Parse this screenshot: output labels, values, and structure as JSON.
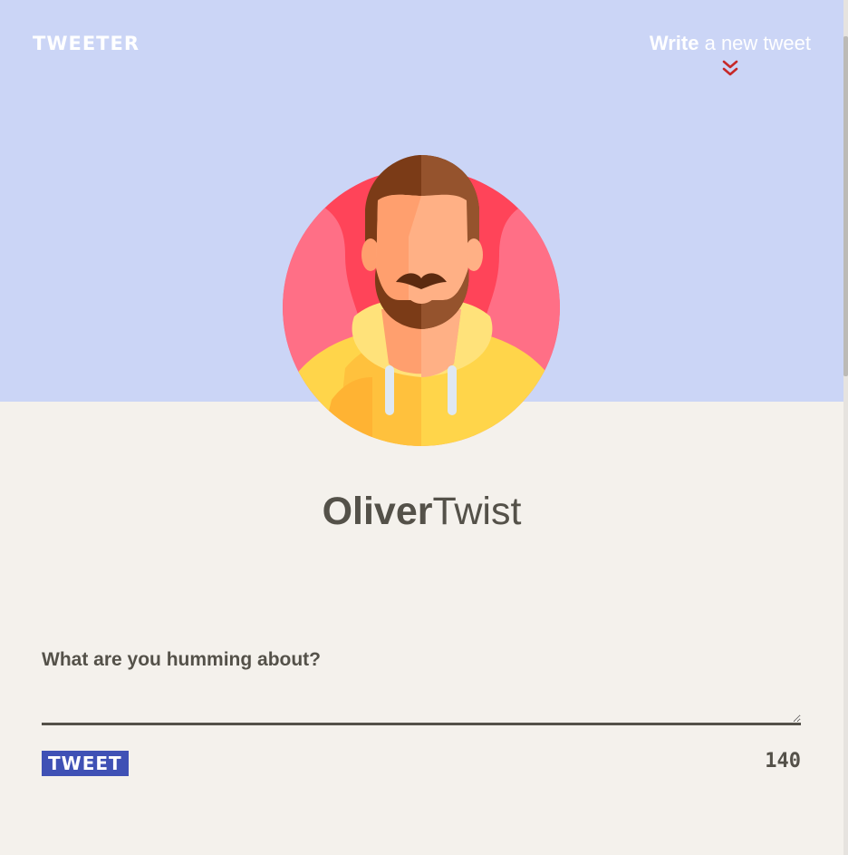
{
  "nav": {
    "logo": "TWEETER",
    "compose_bold": "Write",
    "compose_light": " a new tweet",
    "compose_icon": "double-chevron-down-icon"
  },
  "profile": {
    "first_name": "Oliver",
    "last_name": "Twist",
    "avatar_icon": "bearded-man-avatar"
  },
  "compose": {
    "label": "What are you humming about?",
    "value": "",
    "button_label": "TWEET",
    "char_count": "140"
  },
  "colors": {
    "hero_bg": "#cbd5f6",
    "page_bg": "#f4f1ec",
    "accent": "#3f51b5",
    "text": "#545149",
    "chevron": "#c62828"
  }
}
